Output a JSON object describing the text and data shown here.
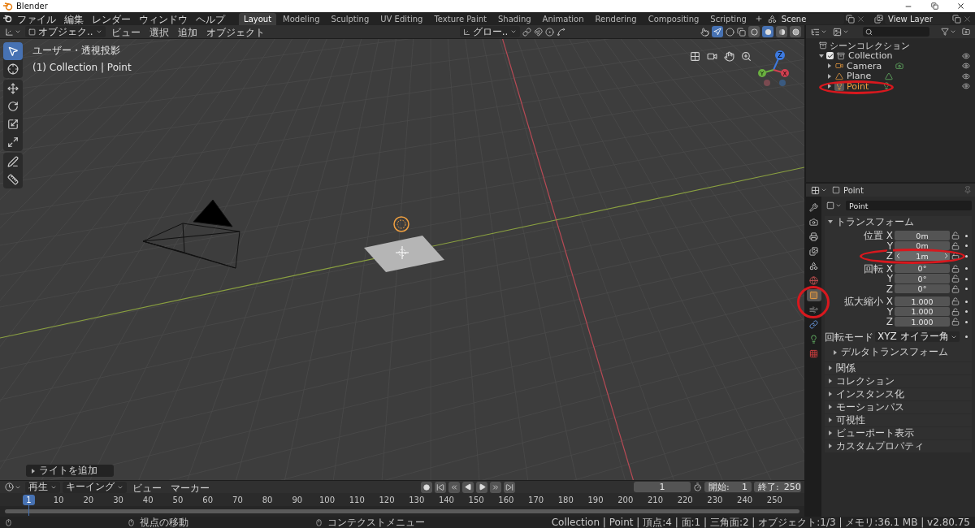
{
  "window": {
    "title": "Blender"
  },
  "menus": [
    "ファイル",
    "編集",
    "レンダー",
    "ウィンドウ",
    "ヘルプ"
  ],
  "workspaces": [
    {
      "label": "Layout",
      "selected": true
    },
    {
      "label": "Modeling",
      "selected": false
    },
    {
      "label": "Sculpting",
      "selected": false
    },
    {
      "label": "UV Editing",
      "selected": false
    },
    {
      "label": "Texture Paint",
      "selected": false
    },
    {
      "label": "Shading",
      "selected": false
    },
    {
      "label": "Animation",
      "selected": false
    },
    {
      "label": "Rendering",
      "selected": false
    },
    {
      "label": "Compositing",
      "selected": false
    },
    {
      "label": "Scripting",
      "selected": false
    }
  ],
  "scene": "Scene",
  "view_layer": "View Layer",
  "viewport": {
    "mode": "オブジェク..",
    "menus": [
      "ビュー",
      "選択",
      "追加",
      "オブジェクト"
    ],
    "orientation": "グロー..",
    "view_name": "ユーザー・透視投影",
    "context": "(1) Collection | Point",
    "last_operation": "ライトを追加",
    "axis_labels": [
      "X",
      "Y",
      "Z"
    ],
    "shading_modes": [
      {
        "kind": "wireframe",
        "selected": false
      },
      {
        "kind": "solid",
        "selected": true
      },
      {
        "kind": "material",
        "selected": false
      },
      {
        "kind": "rendered",
        "selected": false
      }
    ],
    "tools": [
      {
        "kind": "select",
        "selected": true
      },
      {
        "kind": "cursor",
        "selected": false
      },
      {
        "kind": "move",
        "selected": false
      },
      {
        "kind": "rotate",
        "selected": false
      },
      {
        "kind": "scale",
        "selected": false
      },
      {
        "kind": "transform",
        "selected": false
      },
      {
        "kind": "annotate",
        "selected": false
      },
      {
        "kind": "measure",
        "selected": false
      }
    ]
  },
  "outliner": {
    "root": "シーンコレクション",
    "items": [
      {
        "label": "Collection",
        "kind": "collection",
        "checked": true,
        "expanded": true,
        "selected": false,
        "children": [
          {
            "label": "Camera",
            "kind": "camera",
            "expanded": false,
            "selected": false
          },
          {
            "label": "Plane",
            "kind": "mesh",
            "expanded": false,
            "selected": false
          },
          {
            "label": "Point",
            "kind": "light",
            "expanded": false,
            "selected": true
          }
        ]
      }
    ]
  },
  "properties": {
    "header": "Point",
    "object_name": "Point",
    "tabs": [
      {
        "kind": "tool",
        "selected": false
      },
      {
        "kind": "render",
        "selected": false
      },
      {
        "kind": "output",
        "selected": false
      },
      {
        "kind": "view_layer",
        "selected": false
      },
      {
        "kind": "scene",
        "selected": false
      },
      {
        "kind": "world",
        "selected": false
      },
      {
        "kind": "object",
        "selected": true
      },
      {
        "kind": "physics",
        "selected": false
      },
      {
        "kind": "constraints",
        "selected": false
      },
      {
        "kind": "light",
        "selected": false
      },
      {
        "kind": "texture",
        "selected": false
      }
    ],
    "transform": {
      "label": "トランスフォーム",
      "expanded": true,
      "groups": [
        {
          "rows": [
            {
              "label": "位置 X",
              "value": "0m",
              "hovered": false
            },
            {
              "label": "Y",
              "value": "0m",
              "hovered": false
            },
            {
              "label": "Z",
              "value": "1m",
              "hovered": true
            }
          ]
        },
        {
          "rows": [
            {
              "label": "回転 X",
              "value": "0°",
              "hovered": false
            },
            {
              "label": "Y",
              "value": "0°",
              "hovered": false
            },
            {
              "label": "Z",
              "value": "0°",
              "hovered": false
            }
          ]
        },
        {
          "rows": [
            {
              "label": "拡大縮小 X",
              "value": "1.000",
              "hovered": false
            },
            {
              "label": "Y",
              "value": "1.000",
              "hovered": false
            },
            {
              "label": "Z",
              "value": "1.000",
              "hovered": false
            }
          ]
        }
      ],
      "rotation_mode_label": "回転モード",
      "rotation_mode": "XYZ オイラー角",
      "delta": "デルタトランスフォーム"
    },
    "panels": [
      "関係",
      "コレクション",
      "インスタンス化",
      "モーションパス",
      "可視性",
      "ビューポート表示",
      "カスタムプロパティ"
    ]
  },
  "timeline": {
    "menus": [
      "再生",
      "キーイング",
      "ビュー",
      "マーカー"
    ],
    "current_frame": "1",
    "start_label": "開始:",
    "start": "1",
    "end_label": "終了:",
    "end": "250",
    "playhead": "1",
    "ruler": [
      "10",
      "20",
      "30",
      "40",
      "50",
      "60",
      "70",
      "80",
      "90",
      "100",
      "110",
      "120",
      "130",
      "140",
      "150",
      "160",
      "170",
      "180",
      "190",
      "200",
      "210",
      "220",
      "230",
      "240",
      "250"
    ]
  },
  "status_bar": {
    "hints": [
      "視点の移動",
      "コンテクストメニュー"
    ],
    "info": "Collection | Point | 頂点:4 | 面:1 | 三角面:2 | オブジェクト:1/3 | メモリ:36.1 MB | v2.80.75"
  }
}
